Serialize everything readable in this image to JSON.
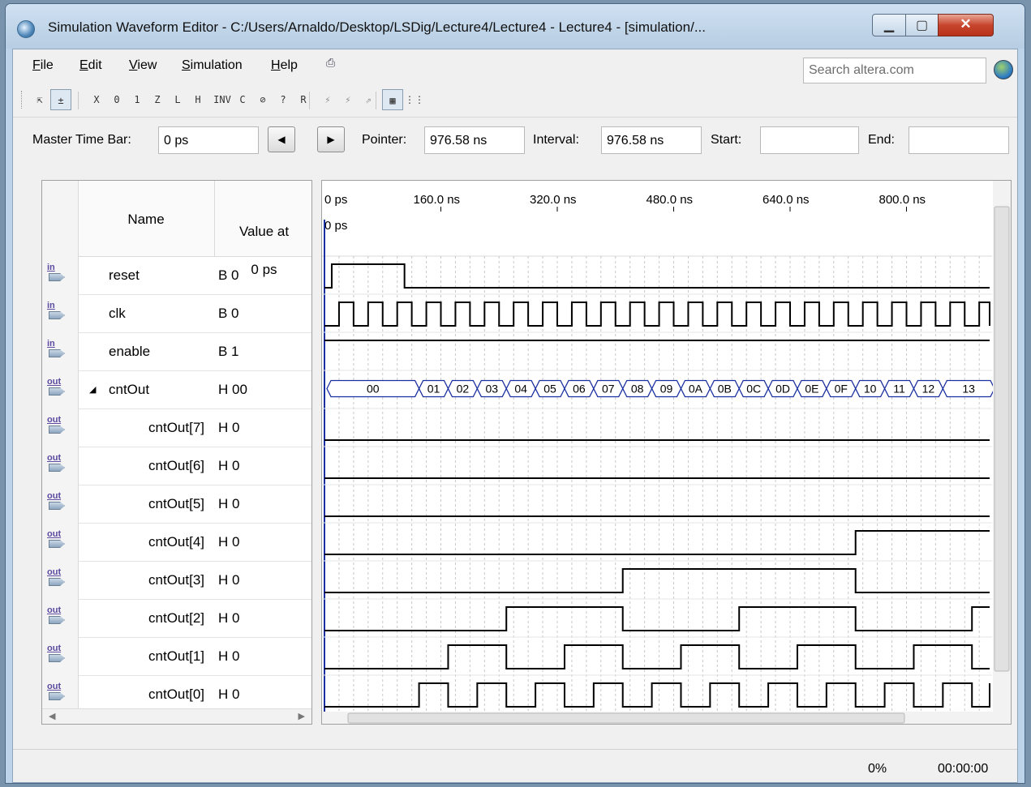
{
  "window": {
    "title": "Simulation Waveform Editor - C:/Users/Arnaldo/Desktop/LSDig/Lecture4/Lecture4 - Lecture4 - [simulation/...",
    "icon": "quartus-app-icon"
  },
  "menu": {
    "items": [
      {
        "key": "F",
        "rest": "ile"
      },
      {
        "key": "E",
        "rest": "dit"
      },
      {
        "key": "V",
        "rest": "iew"
      },
      {
        "key": "S",
        "rest": "imulation"
      },
      {
        "key": "H",
        "rest": "elp"
      }
    ],
    "search_placeholder": "Search altera.com"
  },
  "toolbar": {
    "buttons": [
      {
        "name": "selection-tool-icon",
        "glyph": "⇱"
      },
      {
        "name": "zoom-tool-icon",
        "glyph": "±"
      },
      {
        "name": "forcing-unknown-icon",
        "glyph": "X"
      },
      {
        "name": "forcing-low-icon",
        "glyph": "0"
      },
      {
        "name": "forcing-high-icon",
        "glyph": "1"
      },
      {
        "name": "high-impedance-icon",
        "glyph": "Z"
      },
      {
        "name": "weak-low-icon",
        "glyph": "L"
      },
      {
        "name": "weak-high-icon",
        "glyph": "H"
      },
      {
        "name": "invert-icon",
        "glyph": "INV"
      },
      {
        "name": "count-value-icon",
        "glyph": "C"
      },
      {
        "name": "overwrite-clock-icon",
        "glyph": "⊘"
      },
      {
        "name": "arbitrary-value-icon",
        "glyph": "?"
      },
      {
        "name": "random-values-icon",
        "glyph": "R"
      },
      {
        "name": "run-functional-simulation-icon",
        "glyph": "⚡"
      },
      {
        "name": "run-timing-simulation-icon",
        "glyph": "⚡"
      },
      {
        "name": "generate-netlist-icon",
        "glyph": "⇗"
      },
      {
        "name": "snap-to-grid-icon",
        "glyph": "▦"
      },
      {
        "name": "grid-settings-icon",
        "glyph": "⋮⋮"
      }
    ]
  },
  "timebar": {
    "master_label": "Master Time Bar:",
    "master_value": "0 ps",
    "pointer_label": "Pointer:",
    "pointer_value": "976.58 ns",
    "interval_label": "Interval:",
    "interval_value": "976.58 ns",
    "start_label": "Start:",
    "start_value": "",
    "end_label": "End:",
    "end_value": ""
  },
  "table": {
    "col_name": "Name",
    "col_value_line1": "Value at",
    "col_value_line2": "0 ps",
    "signals": [
      {
        "pin": "in",
        "name": "reset",
        "value": "B 0",
        "indent": 0
      },
      {
        "pin": "in",
        "name": "clk",
        "value": "B 0",
        "indent": 0
      },
      {
        "pin": "in",
        "name": "enable",
        "value": "B 1",
        "indent": 0
      },
      {
        "pin": "out",
        "name": "cntOut",
        "value": "H 00",
        "indent": 0,
        "expanded": true
      },
      {
        "pin": "out",
        "name": "cntOut[7]",
        "value": "H 0",
        "indent": 1
      },
      {
        "pin": "out",
        "name": "cntOut[6]",
        "value": "H 0",
        "indent": 1
      },
      {
        "pin": "out",
        "name": "cntOut[5]",
        "value": "H 0",
        "indent": 1
      },
      {
        "pin": "out",
        "name": "cntOut[4]",
        "value": "H 0",
        "indent": 1
      },
      {
        "pin": "out",
        "name": "cntOut[3]",
        "value": "H 0",
        "indent": 1
      },
      {
        "pin": "out",
        "name": "cntOut[2]",
        "value": "H 0",
        "indent": 1
      },
      {
        "pin": "out",
        "name": "cntOut[1]",
        "value": "H 0",
        "indent": 1
      },
      {
        "pin": "out",
        "name": "cntOut[0]",
        "value": "H 0",
        "indent": 1
      }
    ]
  },
  "waveform": {
    "time_labels": [
      "0 ps",
      "160.0 ns",
      "320.0 ns",
      "480.0 ns",
      "640.0 ns",
      "800.0 ns"
    ],
    "cursor_label": "0 ps",
    "clk_period_ns": 40,
    "reset_high_until_ns": 110,
    "count_start_ns": 130,
    "bus_values": [
      "00",
      "01",
      "02",
      "03",
      "04",
      "05",
      "06",
      "07",
      "08",
      "09",
      "0A",
      "0B",
      "0C",
      "0D",
      "0E",
      "0F",
      "10",
      "11",
      "12",
      "13"
    ],
    "colors": {
      "signal": "#000000",
      "bus": "#1a2fa0",
      "cursor": "#1a2fa0",
      "grid": "#c8c8c8"
    }
  },
  "status": {
    "progress": "0%",
    "elapsed": "00:00:00"
  }
}
